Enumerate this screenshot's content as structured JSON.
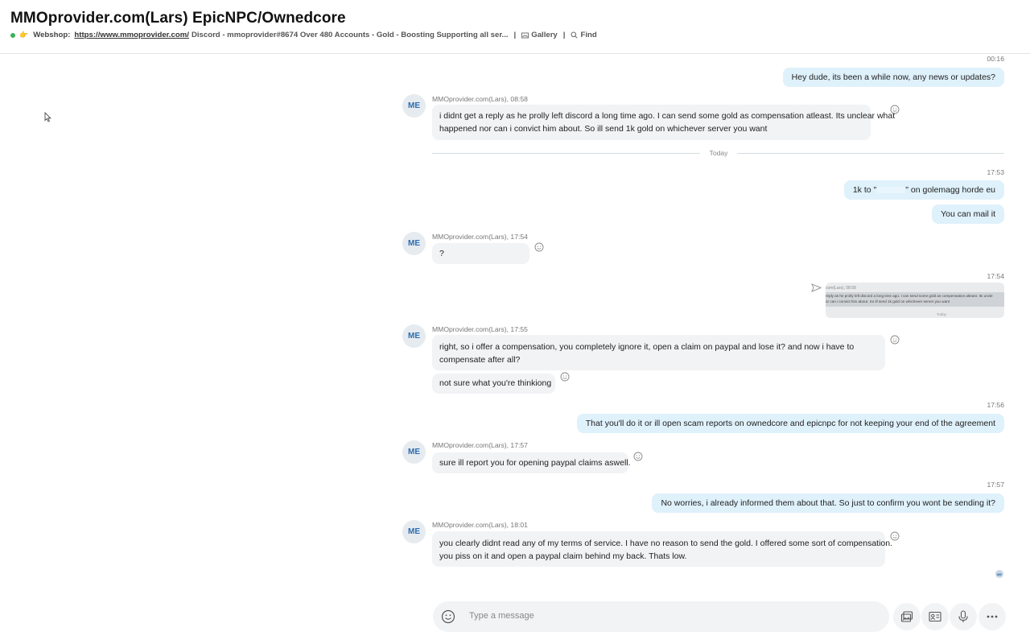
{
  "header": {
    "title": "MMOprovider.com(Lars) EpicNPC/Ownedcore",
    "webshop_label": "Webshop:",
    "webshop_link": "https://www.mmoprovider.com/",
    "mood": "Discord - mmoprovider#8674 Over 480 Accounts - Gold - Boosting Supporting all ser...",
    "gallery_label": "Gallery",
    "find_label": "Find",
    "status_color": "#3cb05a"
  },
  "messages": {
    "m1": {
      "time": "00:16",
      "text": "Hey dude, its been a while now, any news or updates?"
    },
    "m2": {
      "sender": "MMOprovider.com(Lars), 08:58",
      "avatar": "ME",
      "line1": "i didnt get a reply as he prolly left discord a long time ago. I can send some gold as compensation atleast. Its unclear what",
      "line2": "happened nor can i convict him about. So ill send 1k gold on whichever server you want"
    },
    "day_separator": "Today",
    "m3": {
      "time": "17:53",
      "text_a": "1k to \"",
      "text_b": "\" on golemagg horde eu",
      "text2": "You can mail it"
    },
    "m4": {
      "sender": "MMOprovider.com(Lars), 17:54",
      "avatar": "ME",
      "text": "?"
    },
    "m5": {
      "time": "17:54",
      "preview_head": "com(Lars), 08:58",
      "preview_line1": "reply as he prolly left discord a long time ago. I can send some gold as compensation atleast. Its uncle",
      "preview_line2": "or can i convict him about. So ill send 1k gold on whichever server you want",
      "preview_today": "Today"
    },
    "m6": {
      "sender": "MMOprovider.com(Lars), 17:55",
      "avatar": "ME",
      "line1": "right, so i offer a compensation, you completely ignore it, open a claim on paypal and lose it? and now i have to",
      "line2": "compensate after all?",
      "text2": "not sure what you're thinkiong"
    },
    "m7": {
      "time": "17:56",
      "text": "That you'll do it or ill open scam reports on ownedcore and epicnpc for not keeping your end of the agreement"
    },
    "m8": {
      "sender": "MMOprovider.com(Lars), 17:57",
      "avatar": "ME",
      "text": "sure ill report you for opening paypal claims aswell."
    },
    "m9": {
      "time": "17:57",
      "text": "No worries, i already informed them about that.  So just to confirm you wont be sending it?"
    },
    "m10": {
      "sender": "MMOprovider.com(Lars), 18:01",
      "avatar": "ME",
      "line1": "you clearly didnt read any of my terms of service. I have no reason to send the gold. I offered some sort of compensation.",
      "line2": "you piss on it and open a paypal claim behind my back. Thats low."
    },
    "read_receipt": "ME"
  },
  "composer": {
    "placeholder": "Type a message"
  },
  "colors": {
    "outgoing": "#dff1fb",
    "incoming": "#f1f3f5",
    "accent": "#2b6cb0"
  }
}
